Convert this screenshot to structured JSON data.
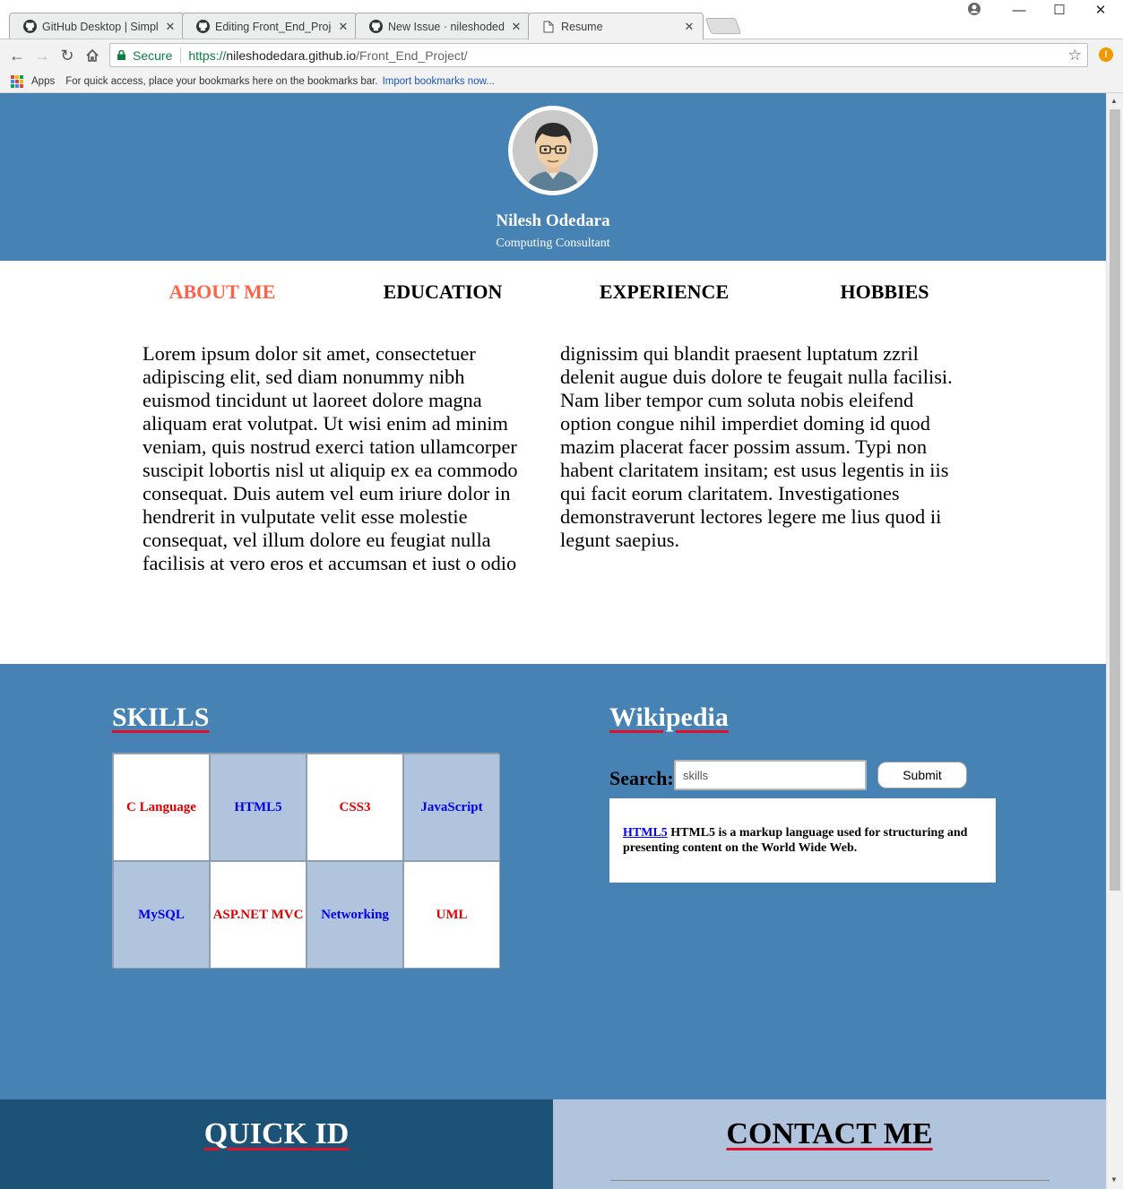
{
  "browser": {
    "tabs": [
      {
        "title": "GitHub Desktop | Simple"
      },
      {
        "title": "Editing Front_End_Projec"
      },
      {
        "title": "New Issue · nileshodedar"
      },
      {
        "title": "Resume"
      }
    ],
    "secure_label": "Secure",
    "url_scheme": "https://",
    "url_host": "nileshodedara.github.io",
    "url_path": "/Front_End_Project/",
    "bookmarks": {
      "apps_label": "Apps",
      "hint": "For quick access, place your bookmarks here on the bookmarks bar.",
      "import_link": "Import bookmarks now..."
    }
  },
  "header": {
    "name": "Nilesh Odedara",
    "role": "Computing Consultant"
  },
  "nav": [
    {
      "label": "ABOUT ME",
      "active": true
    },
    {
      "label": "EDUCATION",
      "active": false
    },
    {
      "label": "EXPERIENCE",
      "active": false
    },
    {
      "label": "HOBBIES",
      "active": false
    }
  ],
  "about": {
    "col1": [
      "Lorem ipsum dolor sit amet, consectetuer",
      "adipiscing elit, sed diam nonummy nibh",
      "euismod tincidunt ut laoreet dolore magna",
      "aliquam erat volutpat. Ut wisi enim ad minim",
      "veniam, quis nostrud exerci tation ullamcorper",
      "suscipit lobortis nisl ut aliquip ex ea commodo",
      "consequat. Duis autem vel eum iriure dolor in",
      "hendrerit in vulputate velit esse molestie",
      "consequat, vel illum dolore eu feugiat nulla",
      "facilisis at vero eros et accumsan et iust o odio"
    ],
    "col2": [
      "dignissim qui blandit praesent luptatum zzril",
      "delenit augue duis dolore te feugait nulla facilisi.",
      "Nam liber tempor cum soluta nobis eleifend",
      "option congue nihil imperdiet doming id quod",
      "mazim placerat facer possim assum. Typi non",
      "habent claritatem insitam; est usus legentis in iis",
      "qui facit eorum claritatem. Investigationes",
      "demonstraverunt lectores legere me lius quod ii",
      "legunt saepius."
    ]
  },
  "skills": {
    "title": "SKILLS",
    "items": [
      {
        "label": "C Language",
        "text_color": "#e00000",
        "bg": "#ffffff"
      },
      {
        "label": "HTML5",
        "text_color": "#0000ee",
        "bg": "#b0c4de"
      },
      {
        "label": "CSS3",
        "text_color": "#e00000",
        "bg": "#ffffff"
      },
      {
        "label": "JavaScript",
        "text_color": "#0000ee",
        "bg": "#b0c4de"
      },
      {
        "label": "MySQL",
        "text_color": "#0000ee",
        "bg": "#b0c4de"
      },
      {
        "label": "ASP.NET MVC",
        "text_color": "#e00000",
        "bg": "#ffffff"
      },
      {
        "label": "Networking",
        "text_color": "#0000ee",
        "bg": "#b0c4de"
      },
      {
        "label": "UML",
        "text_color": "#e00000",
        "bg": "#ffffff"
      }
    ]
  },
  "wikipedia": {
    "title": "Wikipedia",
    "search_label": "Search:",
    "search_value": "skills",
    "submit_label": "Submit",
    "result_link": "HTML5",
    "result_text": " HTML5 is a markup language used for structuring and presenting content on the World Wide Web."
  },
  "footer": {
    "quick_id_title": "QUICK ID",
    "contact_title": "CONTACT ME"
  },
  "colors": {
    "header_bg": "#4682b4",
    "nav_active": "#ff6347",
    "quick_id_bg": "#1b5276",
    "contact_bg": "#b0c4de",
    "underline": "#e0102a"
  }
}
